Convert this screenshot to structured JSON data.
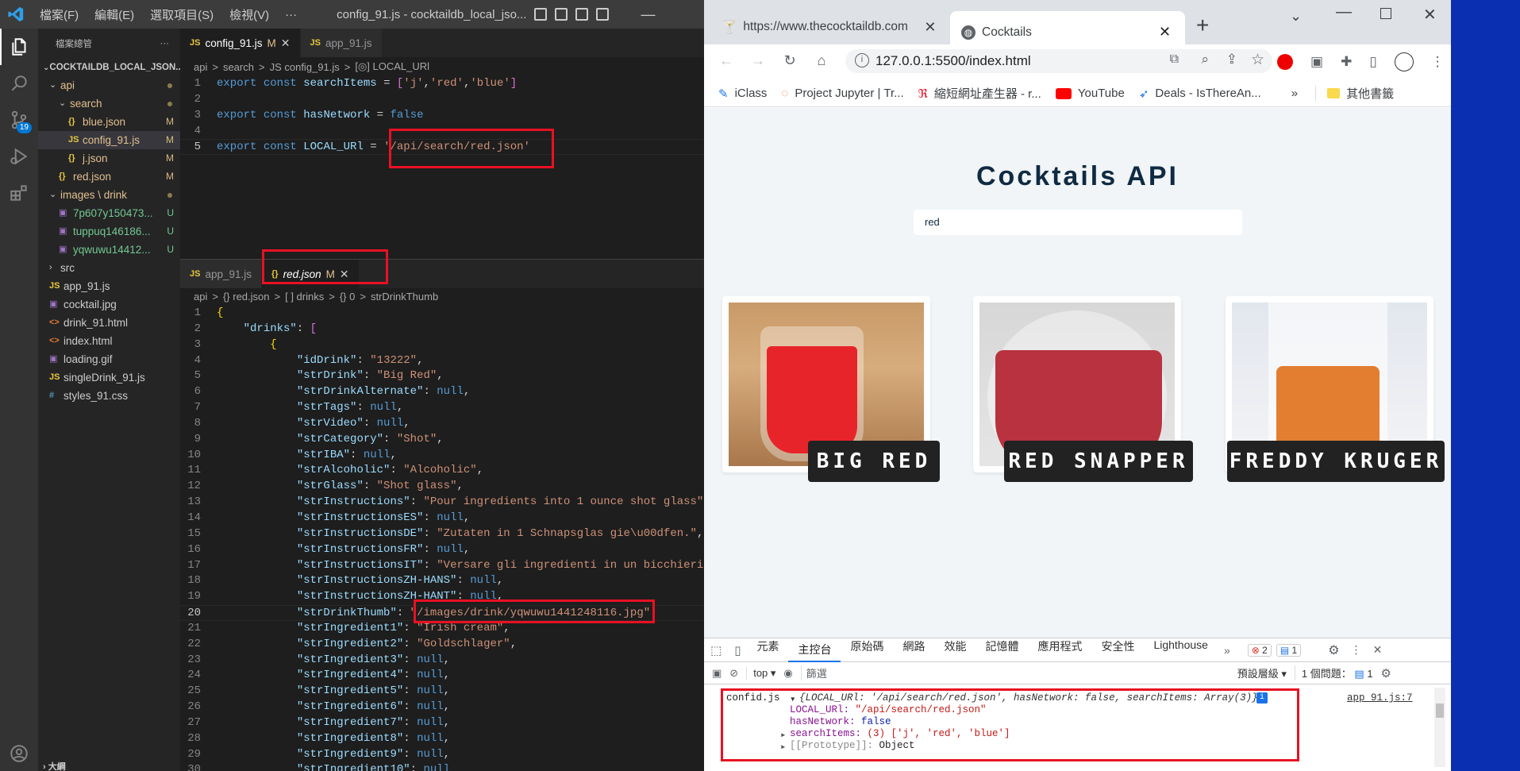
{
  "vscode": {
    "menu": [
      "檔案(F)",
      "編輯(E)",
      "選取項目(S)",
      "檢視(V)",
      "···"
    ],
    "window_title": "config_91.js - cocktaildb_local_jso...",
    "scm_badge": "19",
    "explorer_title": "檔案總管",
    "explorer_more": "···",
    "project": "COCKTAILDB_LOCAL_JSON...",
    "tree": [
      {
        "label": "api",
        "type": "folder",
        "indent": 1,
        "open": true,
        "status": "dot"
      },
      {
        "label": "search",
        "type": "folder",
        "indent": 2,
        "open": true,
        "status": "dot"
      },
      {
        "label": "blue.json",
        "type": "json",
        "indent": 3,
        "status": "M"
      },
      {
        "label": "config_91.js",
        "type": "js",
        "indent": 3,
        "status": "M",
        "selected": true
      },
      {
        "label": "j.json",
        "type": "json",
        "indent": 3,
        "status": "M"
      },
      {
        "label": "red.json",
        "type": "json",
        "indent": 2,
        "status": "M"
      },
      {
        "label": "images \\ drink",
        "type": "folder",
        "indent": 1,
        "open": true,
        "status": "dot"
      },
      {
        "label": "7p607y150473...",
        "type": "img",
        "indent": 2,
        "status": "U"
      },
      {
        "label": "tuppuq146186...",
        "type": "img",
        "indent": 2,
        "status": "U"
      },
      {
        "label": "yqwuwu14412...",
        "type": "img",
        "indent": 2,
        "status": "U"
      },
      {
        "label": "src",
        "type": "folder",
        "indent": 1,
        "open": false,
        "status": ""
      },
      {
        "label": "app_91.js",
        "type": "js",
        "indent": 1,
        "status": ""
      },
      {
        "label": "cocktail.jpg",
        "type": "img",
        "indent": 1,
        "status": ""
      },
      {
        "label": "drink_91.html",
        "type": "html",
        "indent": 1,
        "status": ""
      },
      {
        "label": "index.html",
        "type": "html",
        "indent": 1,
        "status": ""
      },
      {
        "label": "loading.gif",
        "type": "img",
        "indent": 1,
        "status": ""
      },
      {
        "label": "singleDrink_91.js",
        "type": "js",
        "indent": 1,
        "status": ""
      },
      {
        "label": "styles_91.css",
        "type": "css",
        "indent": 1,
        "status": ""
      }
    ],
    "editor1": {
      "tabs": [
        {
          "icon": "JS",
          "label": "config_91.js",
          "mod": "M",
          "active": true
        },
        {
          "icon": "JS",
          "label": "app_91.js",
          "mod": "",
          "active": false
        }
      ],
      "breadcrumb": [
        "api",
        ">",
        "search",
        ">",
        "JS config_91.js",
        ">",
        "[◎] LOCAL_URl"
      ],
      "lines": [
        {
          "n": "1",
          "t": "export const searchItems = ['j','red','blue']"
        },
        {
          "n": "2",
          "t": ""
        },
        {
          "n": "3",
          "t": "export const hasNetwork = false"
        },
        {
          "n": "4",
          "t": ""
        },
        {
          "n": "5",
          "t": "export const LOCAL_URl = '/api/search/red.json'"
        }
      ]
    },
    "editor2": {
      "tabs": [
        {
          "icon": "JS",
          "label": "app_91.js",
          "mod": "",
          "active": false
        },
        {
          "icon": "{}",
          "label": "red.json",
          "mod": "M",
          "active": true
        }
      ],
      "breadcrumb": [
        "api",
        ">",
        "{} red.json",
        ">",
        "[ ] drinks",
        ">",
        "{} 0",
        ">",
        "strDrinkThumb"
      ],
      "lines": [
        {
          "n": "1",
          "t": "{"
        },
        {
          "n": "2",
          "t": "    \"drinks\": ["
        },
        {
          "n": "3",
          "t": "        {"
        },
        {
          "n": "4",
          "t": "            \"idDrink\": \"13222\","
        },
        {
          "n": "5",
          "t": "            \"strDrink\": \"Big Red\","
        },
        {
          "n": "6",
          "t": "            \"strDrinkAlternate\": null,"
        },
        {
          "n": "7",
          "t": "            \"strTags\": null,"
        },
        {
          "n": "8",
          "t": "            \"strVideo\": null,"
        },
        {
          "n": "9",
          "t": "            \"strCategory\": \"Shot\","
        },
        {
          "n": "10",
          "t": "            \"strIBA\": null,"
        },
        {
          "n": "11",
          "t": "            \"strAlcoholic\": \"Alcoholic\","
        },
        {
          "n": "12",
          "t": "            \"strGlass\": \"Shot glass\","
        },
        {
          "n": "13",
          "t": "            \"strInstructions\": \"Pour ingredients into 1 ounce shot glass\""
        },
        {
          "n": "14",
          "t": "            \"strInstructionsES\": null,"
        },
        {
          "n": "15",
          "t": "            \"strInstructionsDE\": \"Zutaten in 1 Schnapsglas gie\\u00dfen.\","
        },
        {
          "n": "16",
          "t": "            \"strInstructionsFR\": null,"
        },
        {
          "n": "17",
          "t": "            \"strInstructionsIT\": \"Versare gli ingredienti in un bicchieri"
        },
        {
          "n": "18",
          "t": "            \"strInstructionsZH-HANS\": null,"
        },
        {
          "n": "19",
          "t": "            \"strInstructionsZH-HANT\": null,"
        },
        {
          "n": "20",
          "t": "            \"strDrinkThumb\": \"/images/drink/yqwuwu1441248116.jpg\""
        },
        {
          "n": "21",
          "t": "            \"strIngredient1\": \"Irish cream\","
        },
        {
          "n": "22",
          "t": "            \"strIngredient2\": \"Goldschlager\","
        },
        {
          "n": "23",
          "t": "            \"strIngredient3\": null,"
        },
        {
          "n": "24",
          "t": "            \"strIngredient4\": null,"
        },
        {
          "n": "25",
          "t": "            \"strIngredient5\": null,"
        },
        {
          "n": "26",
          "t": "            \"strIngredient6\": null,"
        },
        {
          "n": "27",
          "t": "            \"strIngredient7\": null,"
        },
        {
          "n": "28",
          "t": "            \"strIngredient8\": null,"
        },
        {
          "n": "29",
          "t": "            \"strIngredient9\": null,"
        },
        {
          "n": "30",
          "t": "            \"strIngredient10\": null"
        }
      ]
    }
  },
  "browser": {
    "tab1": "https://www.thecocktaildb.com",
    "tab2": "Cocktails",
    "url": "127.0.0.1:5500/index.html",
    "bookmarks": [
      "iClass",
      "Project Jupyter | Tr...",
      "縮短網址產生器 - r...",
      "YouTube",
      "Deals - IsThereAn..."
    ],
    "other_bookmarks": "其他書籤",
    "page": {
      "title": "Cocktails API",
      "search_value": "red",
      "cards": [
        {
          "name": "BIG RED",
          "liquid": "#e8242b"
        },
        {
          "name": "RED SNAPPER",
          "liquid": "#b8323f"
        },
        {
          "name": "FREDDY KRUGER",
          "liquid": "#e0701a"
        }
      ]
    },
    "devtools": {
      "tabs": [
        "元素",
        "主控台",
        "原始碼",
        "網路",
        "效能",
        "記憶體",
        "應用程式",
        "安全性",
        "Lighthouse"
      ],
      "active_tab": "主控台",
      "errors": "2",
      "messages": "1",
      "context": "top",
      "filter_placeholder": "篩選",
      "levels": "預設層級",
      "issues": "1 個問題：",
      "issues_count": "1",
      "console": {
        "label": "confid.js",
        "summary": "{LOCAL_URl: '/api/search/red.json', hasNetwork: false, searchItems: Array(3)}",
        "source": "app_91.js:7",
        "props": [
          {
            "k": "LOCAL_URl:",
            "v": "\"/api/search/red.json\"",
            "c": "s"
          },
          {
            "k": "hasNetwork:",
            "v": "false",
            "c": "b"
          },
          {
            "k": "searchItems:",
            "v": "(3) ['j', 'red', 'blue']",
            "c": "s"
          },
          {
            "k": "[[Prototype]]:",
            "v": "Object",
            "c": "o"
          }
        ]
      }
    }
  }
}
